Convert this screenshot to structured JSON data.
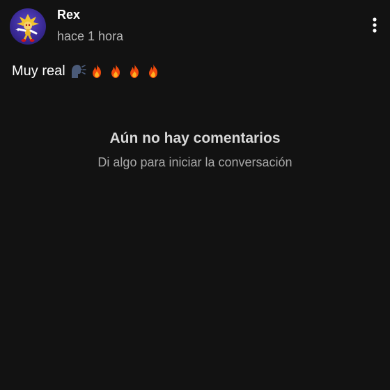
{
  "post": {
    "author": "Rex",
    "timestamp": "hace 1 hora",
    "avatar_icon": "sonic-character-avatar",
    "text": "Muy real",
    "emojis": [
      "speaking-head-emoji",
      "fire-emoji",
      "fire-emoji",
      "fire-emoji",
      "fire-emoji"
    ],
    "menu_icon": "more-vertical-icon"
  },
  "comments": {
    "empty_title": "Aún no hay comentarios",
    "empty_subtitle": "Di algo para iniciar la conversación"
  },
  "colors": {
    "background": "#121212",
    "text_primary": "#ffffff",
    "text_secondary": "#b4b4b4",
    "fire": "#f04a0c",
    "avatar_bg": "#3a2a96"
  }
}
